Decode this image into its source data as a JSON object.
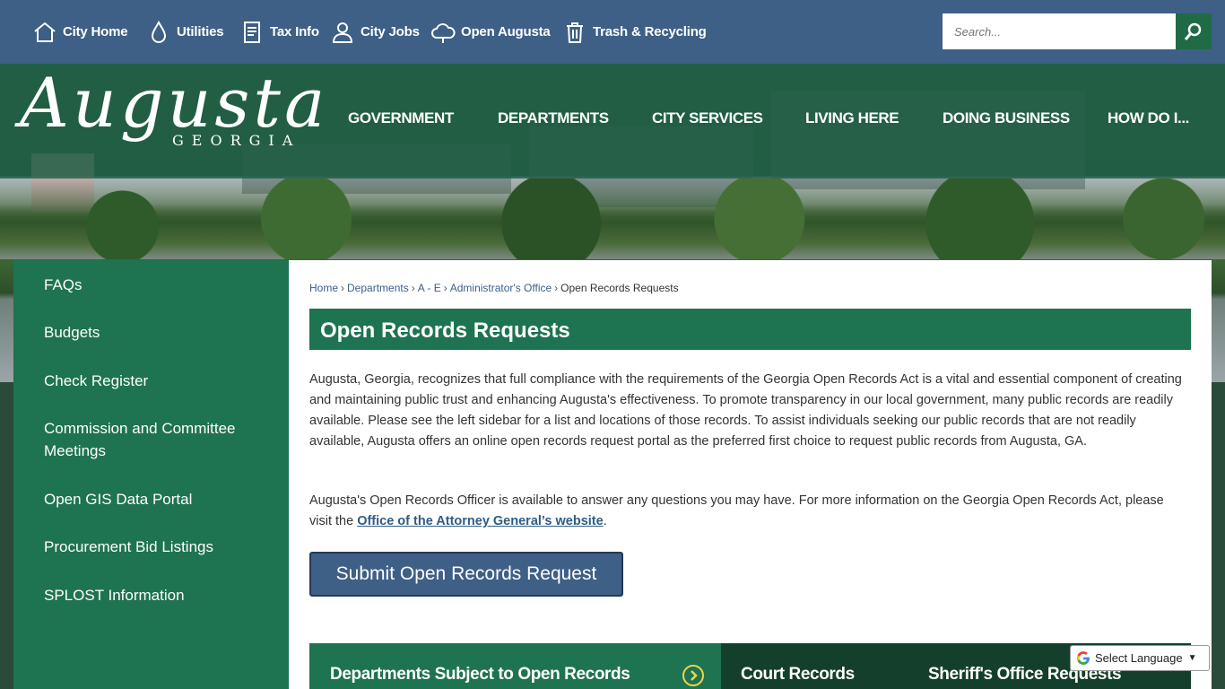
{
  "utility_nav": [
    {
      "label": "City Home",
      "icon": "home-icon"
    },
    {
      "label": "Utilities",
      "icon": "water-drop-icon"
    },
    {
      "label": "Tax Info",
      "icon": "document-icon"
    },
    {
      "label": "City Jobs",
      "icon": "person-icon"
    },
    {
      "label": "Open Augusta",
      "icon": "cloud-icon"
    },
    {
      "label": "Trash & Recycling",
      "icon": "trash-icon"
    }
  ],
  "search": {
    "placeholder": "Search..."
  },
  "logo": {
    "script": "Augusta",
    "sub": "GEORGIA"
  },
  "main_nav": [
    "GOVERNMENT",
    "DEPARTMENTS",
    "CITY SERVICES",
    "LIVING HERE",
    "DOING BUSINESS",
    "HOW DO I..."
  ],
  "sidebar": {
    "items": [
      "FAQs",
      "Budgets",
      "Check Register",
      "Commission and Committee Meetings",
      "Open GIS Data Portal",
      "Procurement Bid Listings",
      "SPLOST Information"
    ]
  },
  "breadcrumb": {
    "links": [
      "Home",
      "Departments",
      "A - E",
      "Administrator's Office"
    ],
    "current": "Open Records Requests",
    "separator": "›"
  },
  "page": {
    "title": "Open Records Requests",
    "para1": "Augusta, Georgia, recognizes that full compliance with the requirements of the Georgia Open Records Act is a vital and essential component of creating and maintaining public trust and enhancing Augusta's effectiveness. To promote transparency in our local government, many public records are readily available. Please see the left sidebar for a list and locations of those records. To assist individuals seeking our public records that are not readily available, Augusta offers an online open records request portal as the preferred first choice to request public records from Augusta, GA.",
    "para2_pre": "Augusta's Open Records Officer is available to answer any questions you may have. For more information on the Georgia Open Records Act, please visit the ",
    "para2_link": "Office of the Attorney General’s website",
    "para2_post": ".",
    "submit_label": "Submit Open Records Request"
  },
  "tiles": [
    "Departments Subject to Open Records",
    "Court Records",
    "Sheriff's Office Requests"
  ],
  "translate": {
    "label": "Select Language"
  },
  "colors": {
    "top_bar": "#3e5f86",
    "green": "#1e7350",
    "dark_green": "#143f2c",
    "accent": "#f2d34b"
  }
}
